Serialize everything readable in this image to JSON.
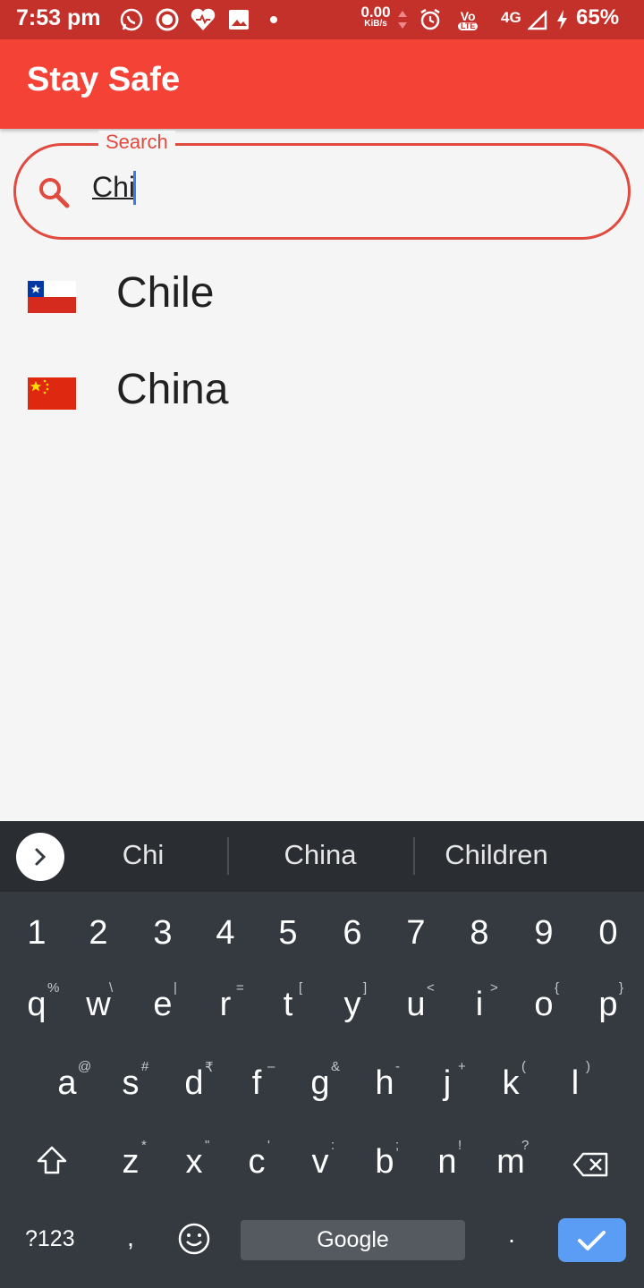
{
  "status_bar": {
    "time": "7:53 pm",
    "net_speed_value": "0.00",
    "net_speed_unit": "KiB/s",
    "volte": "Vo",
    "lte": "LTE",
    "network": "4G",
    "battery": "65%",
    "icons": [
      "whatsapp-icon",
      "record-icon",
      "heart-icon",
      "gallery-icon",
      "dot-icon",
      "alarm-icon",
      "signal-icon",
      "charging-icon"
    ]
  },
  "app_bar": {
    "title": "Stay Safe",
    "color": "#f44336"
  },
  "search": {
    "label": "Search",
    "value": "Chi",
    "icon": "search-icon",
    "accent": "#e04a3f"
  },
  "countries": [
    {
      "name": "Chile",
      "flag": "chile-flag-icon"
    },
    {
      "name": "China",
      "flag": "china-flag-icon"
    }
  ],
  "keyboard": {
    "suggestions": [
      "Chi",
      "China",
      "Children"
    ],
    "numbers": [
      "1",
      "2",
      "3",
      "4",
      "5",
      "6",
      "7",
      "8",
      "9",
      "0"
    ],
    "row1": [
      "q",
      "w",
      "e",
      "r",
      "t",
      "y",
      "u",
      "i",
      "o",
      "p"
    ],
    "row1_hints": [
      "%",
      "\\",
      "|",
      "=",
      "[",
      "]",
      "<",
      ">",
      "{",
      "}"
    ],
    "row2": [
      "a",
      "s",
      "d",
      "f",
      "g",
      "h",
      "j",
      "k",
      "l"
    ],
    "row2_hints": [
      "@",
      "#",
      "₹",
      "–",
      "&",
      "-",
      "+",
      "(",
      ")"
    ],
    "row3": [
      "z",
      "x",
      "c",
      "v",
      "b",
      "n",
      "m"
    ],
    "row3_hints": [
      "*",
      "\"",
      "'",
      ":",
      ";",
      "!",
      "?"
    ],
    "symbols_label": "?123",
    "comma": ",",
    "space_label": "Google",
    "period": ".",
    "enter_color": "#5b9cf5"
  }
}
